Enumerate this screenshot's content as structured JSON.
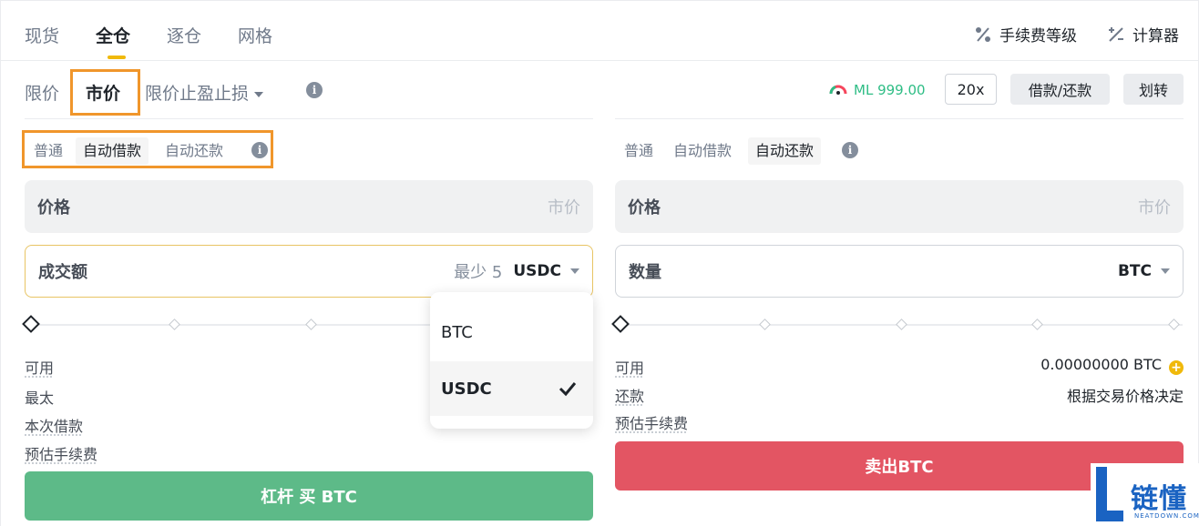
{
  "top_tabs": {
    "spot": "现货",
    "cross": "全仓",
    "isolated": "逐仓",
    "grid": "网格"
  },
  "top_right": {
    "fee_level": "手续费等级",
    "calculator": "计算器"
  },
  "order_types": {
    "limit": "限价",
    "market": "市价",
    "stop_limit": "限价止盈止损"
  },
  "ml": {
    "label": "ML 999.00",
    "color": "#2ebd85"
  },
  "buttons": {
    "leverage": "20x",
    "borrow_repay": "借款/还款",
    "transfer": "划转"
  },
  "buy_panel": {
    "sub_tabs": {
      "normal": "普通",
      "auto_borrow": "自动借款",
      "auto_repay": "自动还款"
    },
    "price_label": "价格",
    "price_hint": "市价",
    "amount_label": "成交额",
    "amount_hint": "最少 5",
    "amount_unit": "USDC",
    "info": {
      "available": "可用",
      "max": "最太",
      "borrow": "本次借款",
      "fee": "预估手续费"
    },
    "button": "杠杆 买 BTC",
    "button_color": "#5dba88"
  },
  "sell_panel": {
    "sub_tabs": {
      "normal": "普通",
      "auto_borrow": "自动借款",
      "auto_repay": "自动还款"
    },
    "price_label": "价格",
    "price_hint": "市价",
    "qty_label": "数量",
    "qty_unit": "BTC",
    "info": {
      "available": "可用",
      "available_value": "0.00000000 BTC",
      "repay": "还款",
      "repay_value": "根据交易价格决定",
      "fee": "预估手续费"
    },
    "button": "卖出BTC",
    "button_color": "#e35563"
  },
  "dropdown": {
    "options": [
      "BTC",
      "USDC"
    ],
    "selected": "USDC"
  },
  "watermark": {
    "text": "链懂",
    "sub": "NEATDOWN.COM"
  },
  "highlight_color": "#f0962b",
  "accent_color": "#f0b90b"
}
